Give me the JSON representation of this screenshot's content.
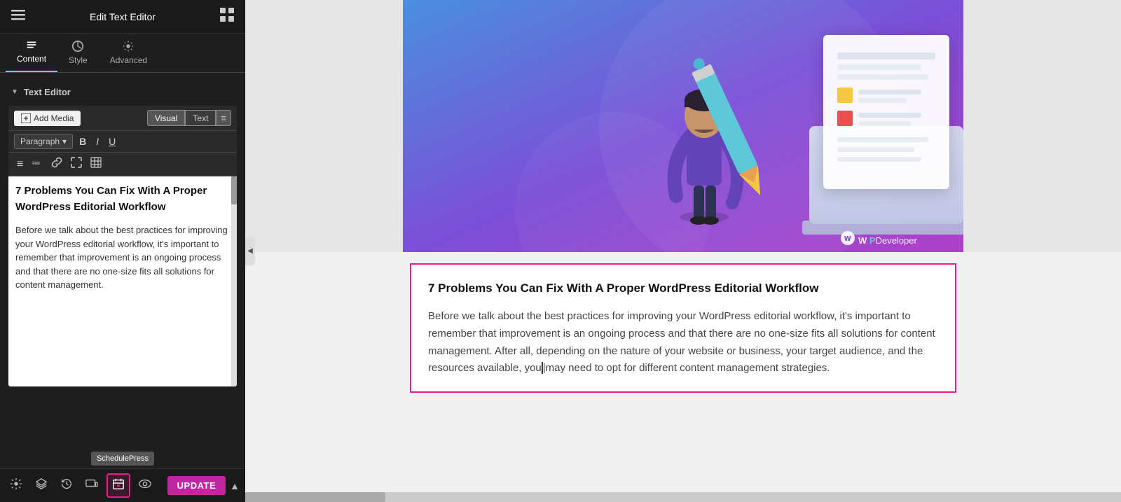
{
  "topbar": {
    "title": "Edit Text Editor",
    "hamburger": "☰",
    "grid": "⊞"
  },
  "tabs": [
    {
      "id": "content",
      "label": "Content",
      "active": true
    },
    {
      "id": "style",
      "label": "Style",
      "active": false
    },
    {
      "id": "advanced",
      "label": "Advanced",
      "active": false
    }
  ],
  "section": {
    "title": "Text Editor",
    "arrow": "▼"
  },
  "editor": {
    "add_media_label": "Add Media",
    "visual_tab": "Visual",
    "text_tab": "Text",
    "format_dropdown": "Paragraph",
    "bold_btn": "B",
    "italic_btn": "I",
    "underline_btn": "U"
  },
  "text_content": {
    "heading": "7 Problems You Can Fix With A Proper WordPress Editorial Workflow",
    "body": "Before we talk about the best practices for improving your WordPress editorial workflow, it's important to remember that improvement is an ongoing process and that there are no one-size fits all solutions for content management."
  },
  "bottom_toolbar": {
    "update_label": "UPDATE",
    "schedulepress_tooltip": "SchedulePress"
  },
  "main_content": {
    "article_heading": "7 Problems You Can Fix With A Proper WordPress Editorial Workflow",
    "article_body1": "Before we talk about the best practices for improving your WordPress editorial workflow, it's important to remember that improvement is an ongoing process and that there are no one-size fits all solutions for content management. After all, depending on the nature of your website or business, your target audience, and the resources available, you may need to opt for different content management strategies.",
    "wpdeveloper": "WPDeveloper"
  }
}
